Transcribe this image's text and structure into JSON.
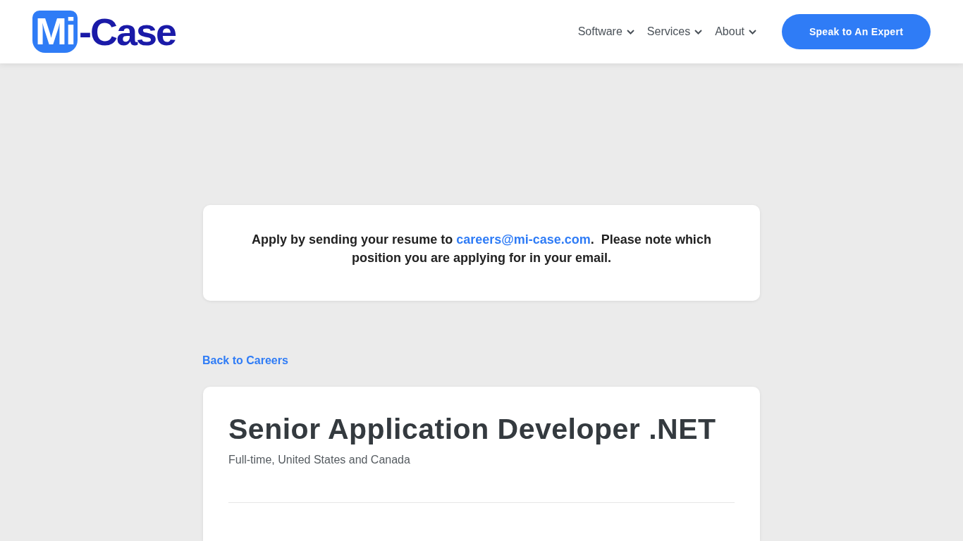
{
  "header": {
    "logo": {
      "badge": "Mi",
      "text": "-Case"
    },
    "nav": [
      {
        "label": "Software"
      },
      {
        "label": "Services"
      },
      {
        "label": "About"
      }
    ],
    "cta": "Speak to An Expert"
  },
  "notice": {
    "before": "Apply by sending your resume to ",
    "link": "careers@mi-case.com",
    "after": ".  Please note which position you are applying for in your email."
  },
  "back_link": "Back to Careers",
  "job": {
    "title": "Senior Application Developer .NET",
    "subtitle": "Full-time, United States and Canada"
  }
}
